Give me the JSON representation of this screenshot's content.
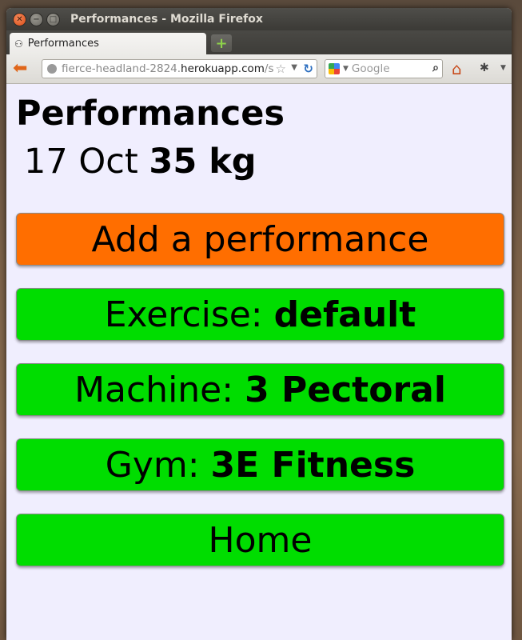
{
  "window": {
    "title": "Performances - Mozilla Firefox"
  },
  "tab": {
    "label": "Performances",
    "new_tab": "+"
  },
  "navbar": {
    "url_prefix": "fierce-headland-2824.",
    "url_domain": "herokuapp.com",
    "url_suffix": "/s",
    "search_placeholder": "Google"
  },
  "page": {
    "heading": "Performances",
    "entry_date": "17 Oct",
    "entry_weight": "35 kg",
    "add_label": "Add a performance",
    "exercise_label": "Exercise:",
    "exercise_value": "default",
    "machine_label": "Machine:",
    "machine_value": "3 Pectoral",
    "gym_label": "Gym:",
    "gym_value": "3E Fitness",
    "home_label": "Home"
  },
  "colors": {
    "add_button": "#ff6e00",
    "nav_button": "#00dd00",
    "page_background": "#f0eefe"
  }
}
